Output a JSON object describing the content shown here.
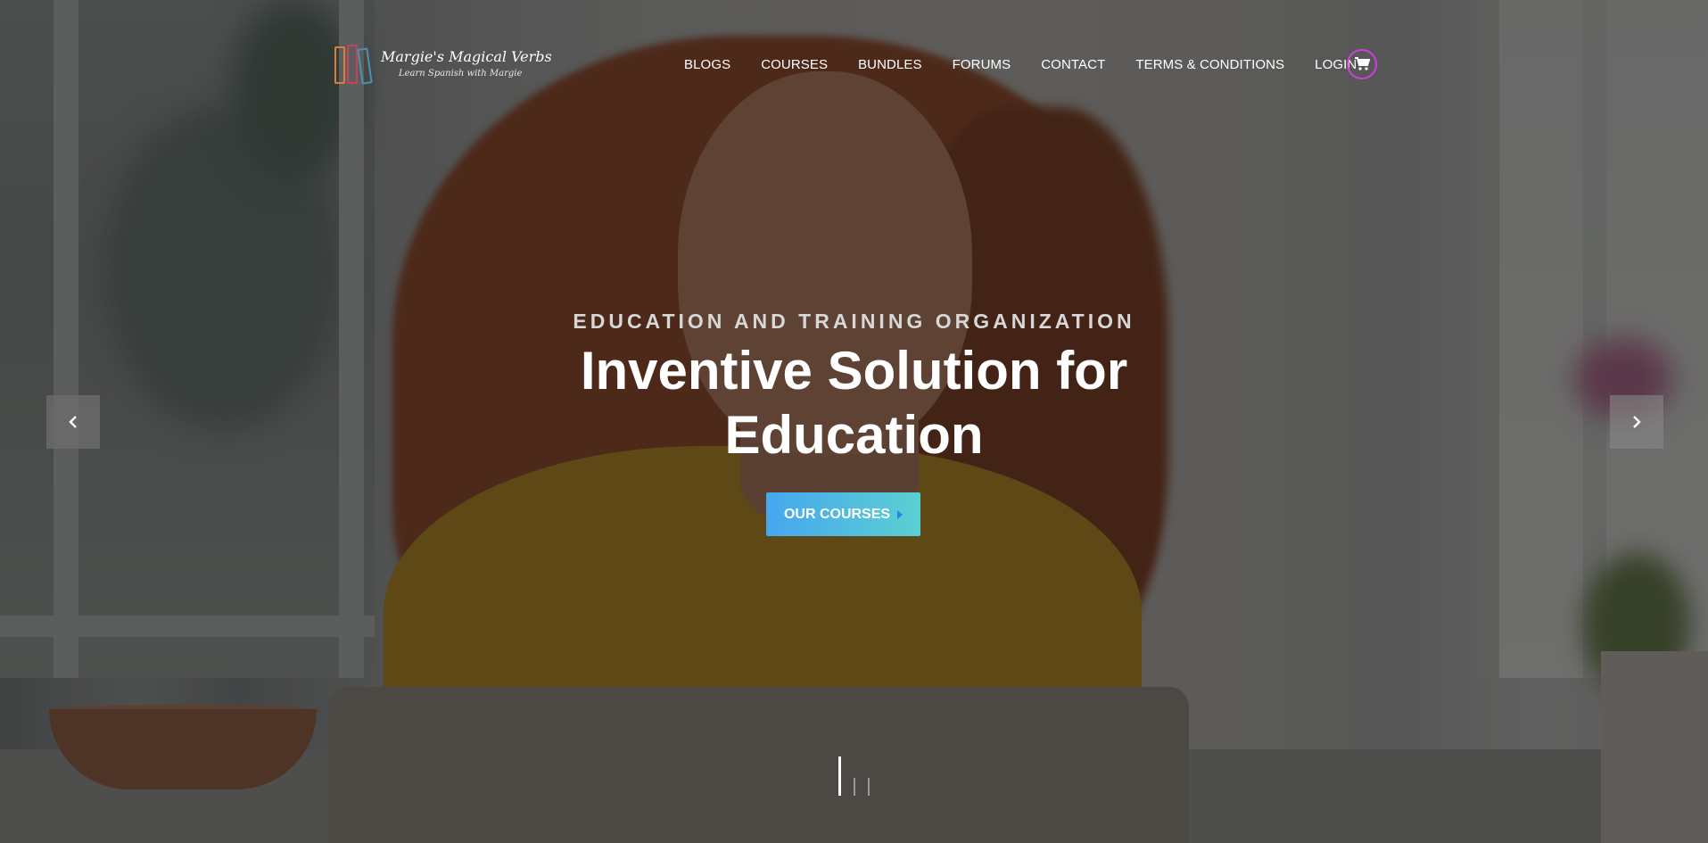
{
  "header": {
    "logo": {
      "title": "Margie's Magical Verbs",
      "subtitle": "Learn Spanish with Margie",
      "icon": "books-icon"
    },
    "nav": [
      {
        "label": "BLOGS"
      },
      {
        "label": "COURSES"
      },
      {
        "label": "BUNDLES"
      },
      {
        "label": "FORUMS"
      },
      {
        "label": "CONTACT"
      },
      {
        "label": "TERMS & CONDITIONS"
      },
      {
        "label": "LOGIN"
      }
    ],
    "cart": {
      "icon": "cart-icon",
      "ring_color": "#cf3fe0"
    }
  },
  "hero": {
    "eyebrow": "EDUCATION AND TRAINING ORGANIZATION",
    "headline_line1": "Inventive Solution for",
    "headline_line2": "Education",
    "cta_label": "OUR COURSES",
    "cta_gradient": [
      "#45a7ef",
      "#5ccfd2"
    ],
    "prev_icon": "chevron-left-icon",
    "next_icon": "chevron-right-icon",
    "slides": {
      "total": 3,
      "active": 1
    }
  }
}
